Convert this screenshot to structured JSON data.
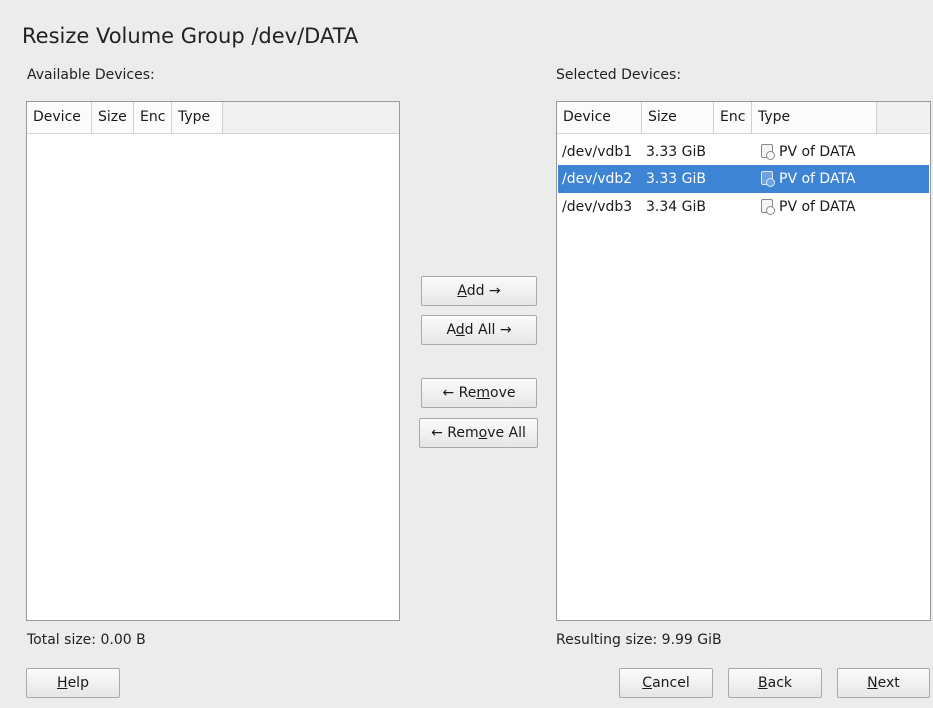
{
  "title": "Resize Volume Group /dev/DATA",
  "available": {
    "label": "Available Devices:",
    "columns": [
      "Device",
      "Size",
      "Enc",
      "Type"
    ],
    "rows": [],
    "total_label": "Total size: 0.00 B"
  },
  "selected": {
    "label": "Selected Devices:",
    "columns": [
      "Device",
      "Size",
      "Enc",
      "Type"
    ],
    "rows": [
      {
        "device": "/dev/vdb1",
        "size": "3.33 GiB",
        "enc": "",
        "type": "PV of DATA",
        "selected": false
      },
      {
        "device": "/dev/vdb2",
        "size": "3.33 GiB",
        "enc": "",
        "type": "PV of DATA",
        "selected": true
      },
      {
        "device": "/dev/vdb3",
        "size": "3.34 GiB",
        "enc": "",
        "type": "PV of DATA",
        "selected": false
      }
    ],
    "resulting_label": "Resulting size: 9.99 GiB"
  },
  "buttons": {
    "add": {
      "pre": "",
      "key": "A",
      "post": "dd →"
    },
    "add_all": {
      "pre": "A",
      "key": "d",
      "post": "d All →"
    },
    "remove": {
      "pre": "← Re",
      "key": "m",
      "post": "ove"
    },
    "remove_all": {
      "pre": "← Rem",
      "key": "o",
      "post": "ve All"
    },
    "help": {
      "pre": "",
      "key": "H",
      "post": "elp"
    },
    "cancel": {
      "pre": "",
      "key": "C",
      "post": "ancel"
    },
    "back": {
      "pre": "",
      "key": "B",
      "post": "ack"
    },
    "next": {
      "pre": "",
      "key": "N",
      "post": "ext"
    }
  },
  "colors": {
    "selection": "#3d84d4",
    "background": "#ececec"
  }
}
